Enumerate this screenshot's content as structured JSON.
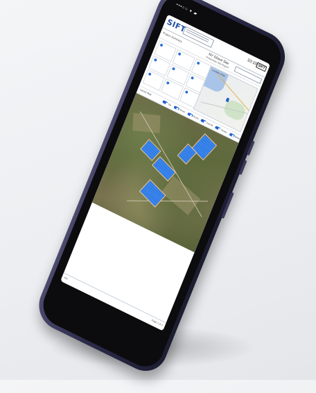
{
  "status": {
    "signal": "•••○○ ▾ ▰"
  },
  "header": {
    "logo_text": "SIFT",
    "time": "10:10",
    "badge": "SIFT"
  },
  "info": {
    "left_label": "Project Summary",
    "title": "NY Ghent Site",
    "subtitle": "Preliminary Site Report",
    "search_placeholder": ""
  },
  "cards": [
    {
      "icon": "location-icon",
      "label": ""
    },
    {
      "icon": "panel-icon",
      "label": ""
    },
    {
      "icon": "bolt-icon",
      "label": ""
    },
    {
      "icon": "acreage-icon",
      "label": ""
    },
    {
      "icon": "tracker-icon",
      "label": ""
    },
    {
      "icon": "grid-icon",
      "label": ""
    },
    {
      "icon": "chart-icon",
      "label": ""
    },
    {
      "icon": "cost-icon",
      "label": ""
    },
    {
      "icon": "storage-icon",
      "label": ""
    }
  ],
  "map": {
    "title": "Location Map"
  },
  "layers": {
    "label": "Layout Map",
    "toggles": [
      "Sat",
      "Terrain",
      "Roads",
      "Parcels",
      "Panels",
      "Setbacks"
    ]
  },
  "footer": {
    "left": "Info",
    "right": "Page 1 of 1"
  },
  "colors": {
    "accent": "#1f5fcf",
    "panel_blue": "#3a87f0",
    "phone_frame": "#2d2c4b"
  }
}
